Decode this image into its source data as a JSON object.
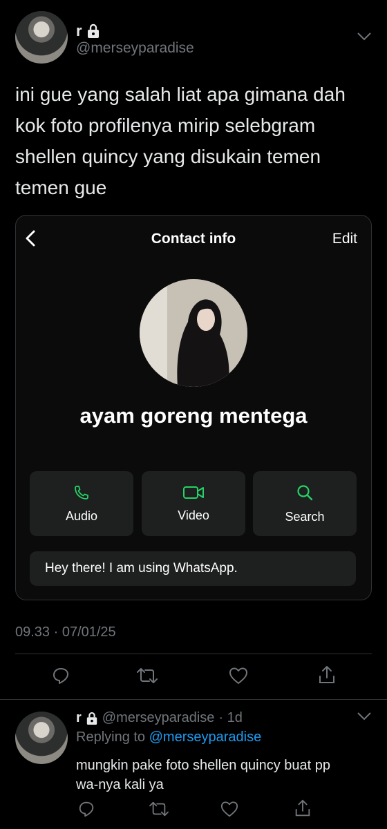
{
  "tweet": {
    "display_name": "r",
    "handle": "@merseyparadise",
    "text_lines": [
      "ini gue yang salah liat apa gimana dah",
      "kok foto profilenya mirip selebgram",
      "shellen quincy yang disukain temen",
      "temen gue"
    ],
    "timestamp": "09.33 · 07/01/25"
  },
  "embedded": {
    "title": "Contact info",
    "edit_label": "Edit",
    "contact_name": "ayam goreng mentega",
    "actions": [
      {
        "label": "Audio",
        "icon": "phone-icon"
      },
      {
        "label": "Video",
        "icon": "video-camera-icon"
      },
      {
        "label": "Search",
        "icon": "search-icon"
      }
    ],
    "status": "Hey there! I am using WhatsApp.",
    "accent_color": "#25d366"
  },
  "reply": {
    "display_name": "r",
    "handle": "@merseyparadise",
    "age": "· 1d",
    "replying_prefix": "Replying to",
    "replying_handle": "@merseyparadise",
    "text_lines": [
      "mungkin pake foto shellen quincy buat pp",
      "wa-nya kali ya"
    ]
  },
  "colors": {
    "background": "#000000",
    "muted": "#71767b",
    "link": "#1d9bf0"
  }
}
